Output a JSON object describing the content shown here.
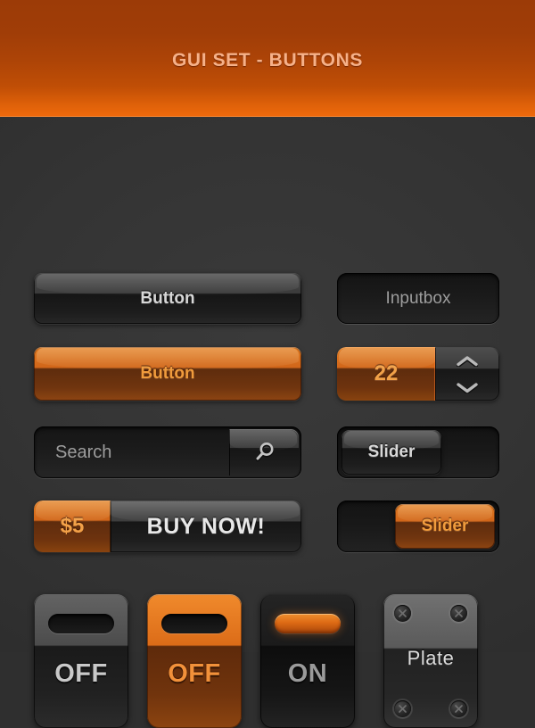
{
  "header": {
    "title": "GUI SET - BUTTONS",
    "background_top": "#9c3b07",
    "background_bottom": "#f06a0c",
    "title_color": "#f6b189"
  },
  "theme": {
    "page_background": "#333333",
    "accent_orange": "#dd6a14",
    "accent_orange_light": "#f09b3c",
    "text_light": "#d7d7d7",
    "text_muted": "#9d9d9d"
  },
  "controls": {
    "dark_button": {
      "label": "Button"
    },
    "inputbox": {
      "value": "Inputbox",
      "placeholder": "Inputbox"
    },
    "orange_button": {
      "label": "Button"
    },
    "spinner": {
      "value": "22",
      "increment_icon": "chevron-up-icon",
      "decrement_icon": "chevron-down-icon"
    },
    "search": {
      "placeholder": "Search",
      "value": "Search",
      "icon": "search-icon"
    },
    "slider_dark": {
      "handle_label": "Slider",
      "position": "left"
    },
    "buy": {
      "price_label": "$5",
      "action_label": "BUY NOW!"
    },
    "slider_orange": {
      "handle_label": "Slider",
      "position": "right"
    }
  },
  "tiles": [
    {
      "label": "OFF",
      "state": "off",
      "style": "dark",
      "indicator": "slot-off"
    },
    {
      "label": "OFF",
      "state": "off",
      "style": "orange",
      "indicator": "slot-off"
    },
    {
      "label": "ON",
      "state": "on",
      "style": "dark",
      "indicator": "slot-on"
    },
    {
      "label": "Plate",
      "state": "static",
      "style": "metal",
      "indicator": "screws"
    }
  ]
}
